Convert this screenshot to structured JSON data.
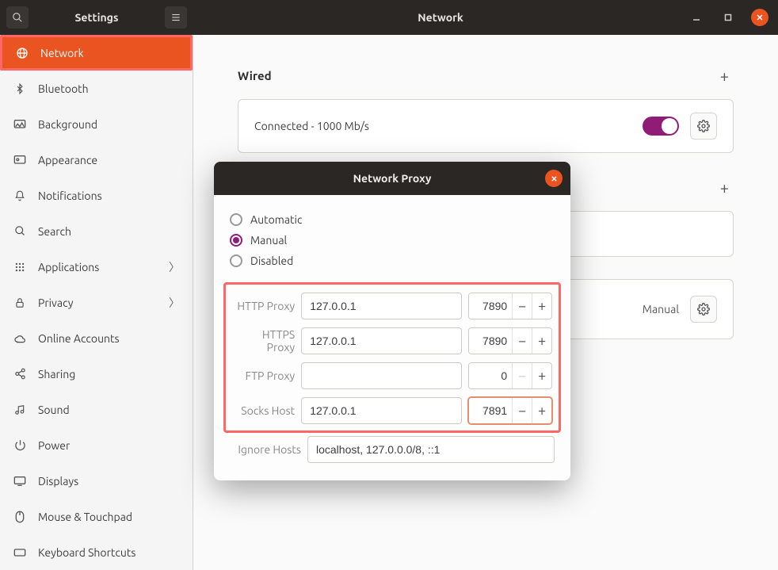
{
  "titlebar": {
    "app": "Settings",
    "page": "Network"
  },
  "sidebar": {
    "items": [
      {
        "label": "Network"
      },
      {
        "label": "Bluetooth"
      },
      {
        "label": "Background"
      },
      {
        "label": "Appearance"
      },
      {
        "label": "Notifications"
      },
      {
        "label": "Search"
      },
      {
        "label": "Applications"
      },
      {
        "label": "Privacy"
      },
      {
        "label": "Online Accounts"
      },
      {
        "label": "Sharing"
      },
      {
        "label": "Sound"
      },
      {
        "label": "Power"
      },
      {
        "label": "Displays"
      },
      {
        "label": "Mouse & Touchpad"
      },
      {
        "label": "Keyboard Shortcuts"
      }
    ]
  },
  "wired": {
    "title": "Wired",
    "status": "Connected - 1000 Mb/s"
  },
  "proxy_section": {
    "mode_label": "Manual"
  },
  "modal": {
    "title": "Network Proxy",
    "options": {
      "automatic": "Automatic",
      "manual": "Manual",
      "disabled": "Disabled"
    },
    "selected": "manual",
    "rows": {
      "http": {
        "label": "HTTP Proxy",
        "host": "127.0.0.1",
        "port": "7890"
      },
      "https": {
        "label": "HTTPS Proxy",
        "host": "127.0.0.1",
        "port": "7890"
      },
      "ftp": {
        "label": "FTP Proxy",
        "host": "",
        "port": "0"
      },
      "socks": {
        "label": "Socks Host",
        "host": "127.0.0.1",
        "port": "7891"
      }
    },
    "ignore": {
      "label": "Ignore Hosts",
      "value": "localhost, 127.0.0.0/8, ::1"
    }
  }
}
